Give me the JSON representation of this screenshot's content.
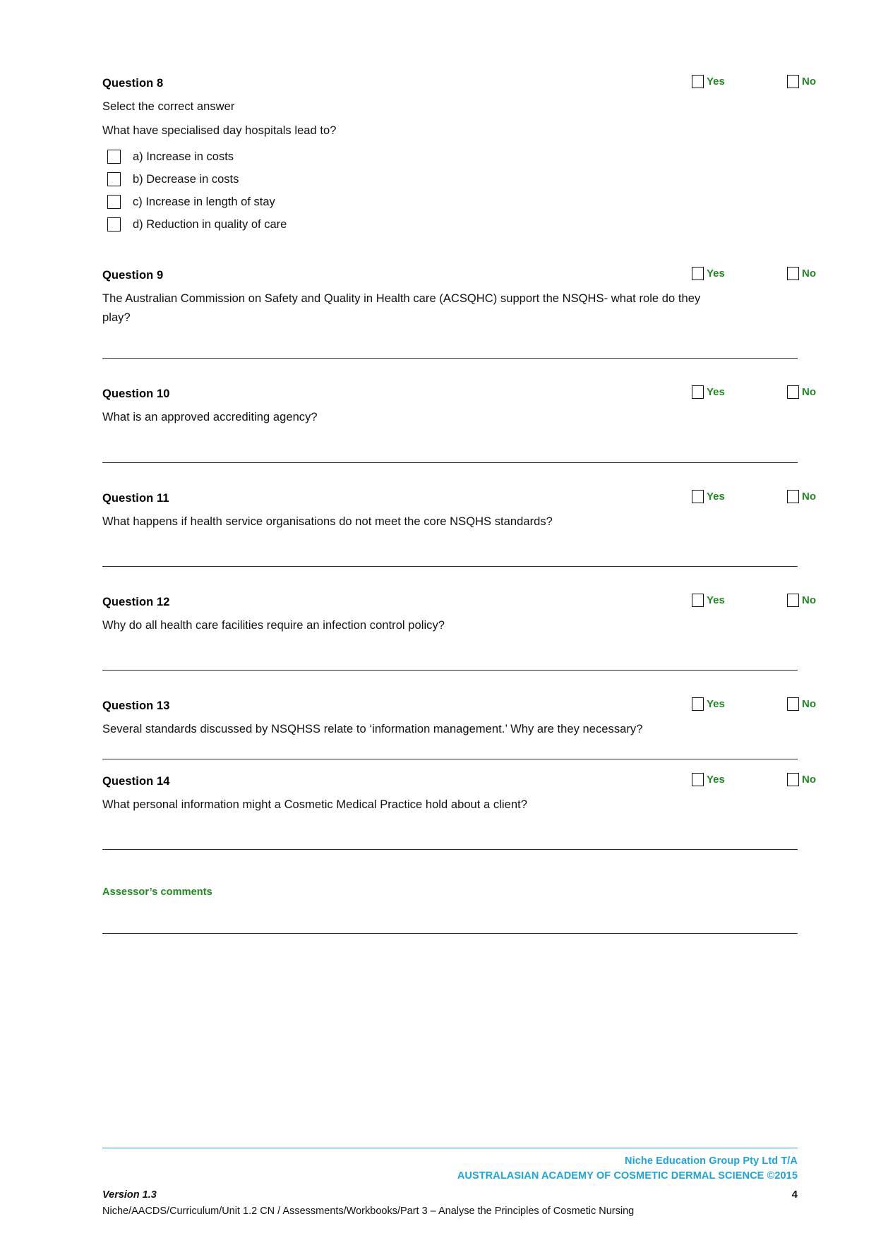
{
  "document": {
    "yes_label": "Yes",
    "no_label": "No",
    "assessor_comments_label": "Assessor’s comments"
  },
  "questions": [
    {
      "id": "q8",
      "title": "Question 8",
      "instruction": "Select the correct answer",
      "prompt": "What have specialised day hospitals lead to?",
      "options": [
        "a) Increase in costs",
        "b) Decrease in costs",
        "c) Increase in length of stay",
        "d) Reduction in quality of care"
      ]
    },
    {
      "id": "q9",
      "title": "Question 9",
      "prompt": "The Australian Commission on Safety and Quality in Health care (ACSQHC) support the NSQHS- what role do they play?"
    },
    {
      "id": "q10",
      "title": "Question 10",
      "prompt": "What is an approved accrediting agency?"
    },
    {
      "id": "q11",
      "title": "Question 11",
      "prompt": "What happens if health service organisations do not meet the core NSQHS standards?"
    },
    {
      "id": "q12",
      "title": "Question 12",
      "prompt": "Why do all health care facilities require an infection control policy?"
    },
    {
      "id": "q13",
      "title": "Question 13",
      "prompt": "Several standards discussed by NSQHSS relate to ‘information management.’  Why are they necessary?"
    },
    {
      "id": "q14",
      "title": "Question 14",
      "prompt": "What personal information might a Cosmetic Medical Practice hold about a client?"
    }
  ],
  "footer": {
    "brand_line1": "Niche Education Group Pty Ltd T/A",
    "brand_line2": "AUSTRALASIAN ACADEMY OF COSMETIC DERMAL SCIENCE ©2015",
    "version": "Version 1.3",
    "page_number": "4",
    "path": "Niche/AACDS/Curriculum/Unit 1.2 CN / Assessments/Workbooks/Part 3 – Analyse the Principles of Cosmetic Nursing"
  },
  "colors": {
    "green": "#1e8b1e",
    "blue": "#1da4dd",
    "rule": "#2b2b2b"
  }
}
